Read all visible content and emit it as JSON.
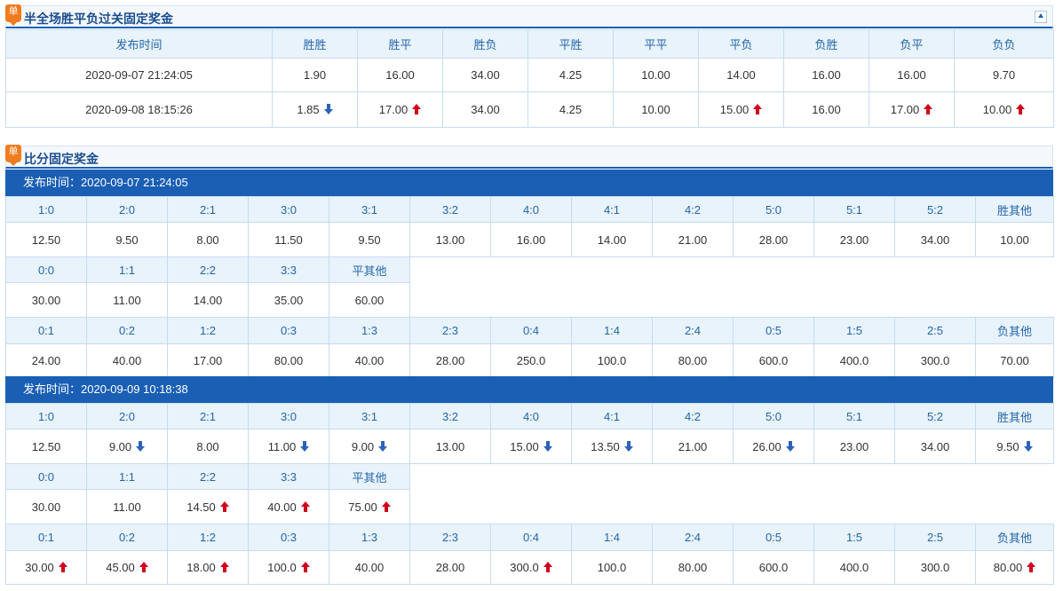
{
  "colors": {
    "accent": "#1a5fb4",
    "header_bg": "#e8f3fc",
    "header_text": "#2566a8",
    "up": "#d0021b",
    "down": "#2c62b8",
    "badge": "#f07c1e"
  },
  "badge_label": "单",
  "halftime": {
    "title": "半全场胜平负过关固定奖金",
    "headers": [
      "发布时间",
      "胜胜",
      "胜平",
      "胜负",
      "平胜",
      "平平",
      "平负",
      "负胜",
      "负平",
      "负负"
    ],
    "rows": [
      {
        "time": "2020-09-07 21:24:05",
        "cells": [
          {
            "v": "1.90",
            "t": ""
          },
          {
            "v": "16.00",
            "t": ""
          },
          {
            "v": "34.00",
            "t": ""
          },
          {
            "v": "4.25",
            "t": ""
          },
          {
            "v": "10.00",
            "t": ""
          },
          {
            "v": "14.00",
            "t": ""
          },
          {
            "v": "16.00",
            "t": ""
          },
          {
            "v": "16.00",
            "t": ""
          },
          {
            "v": "9.70",
            "t": ""
          }
        ]
      },
      {
        "time": "2020-09-08 18:15:26",
        "cells": [
          {
            "v": "1.85",
            "t": "down"
          },
          {
            "v": "17.00",
            "t": "up"
          },
          {
            "v": "34.00",
            "t": ""
          },
          {
            "v": "4.25",
            "t": ""
          },
          {
            "v": "10.00",
            "t": ""
          },
          {
            "v": "15.00",
            "t": "up"
          },
          {
            "v": "16.00",
            "t": ""
          },
          {
            "v": "17.00",
            "t": "up"
          },
          {
            "v": "10.00",
            "t": "up"
          }
        ]
      }
    ]
  },
  "score": {
    "title": "比分固定奖金",
    "publish_label": "发布时间：",
    "win_labels": [
      "1:0",
      "2:0",
      "2:1",
      "3:0",
      "3:1",
      "3:2",
      "4:0",
      "4:1",
      "4:2",
      "5:0",
      "5:1",
      "5:2",
      "胜其他"
    ],
    "draw_labels": [
      "0:0",
      "1:1",
      "2:2",
      "3:3",
      "平其他"
    ],
    "lose_labels": [
      "0:1",
      "0:2",
      "1:2",
      "0:3",
      "1:3",
      "2:3",
      "0:4",
      "1:4",
      "2:4",
      "0:5",
      "1:5",
      "2:5",
      "负其他"
    ],
    "releases": [
      {
        "time": "2020-09-07 21:24:05",
        "win": [
          {
            "v": "12.50",
            "t": ""
          },
          {
            "v": "9.50",
            "t": ""
          },
          {
            "v": "8.00",
            "t": ""
          },
          {
            "v": "11.50",
            "t": ""
          },
          {
            "v": "9.50",
            "t": ""
          },
          {
            "v": "13.00",
            "t": ""
          },
          {
            "v": "16.00",
            "t": ""
          },
          {
            "v": "14.00",
            "t": ""
          },
          {
            "v": "21.00",
            "t": ""
          },
          {
            "v": "28.00",
            "t": ""
          },
          {
            "v": "23.00",
            "t": ""
          },
          {
            "v": "34.00",
            "t": ""
          },
          {
            "v": "10.00",
            "t": ""
          }
        ],
        "draw": [
          {
            "v": "30.00",
            "t": ""
          },
          {
            "v": "11.00",
            "t": ""
          },
          {
            "v": "14.00",
            "t": ""
          },
          {
            "v": "35.00",
            "t": ""
          },
          {
            "v": "60.00",
            "t": ""
          }
        ],
        "lose": [
          {
            "v": "24.00",
            "t": ""
          },
          {
            "v": "40.00",
            "t": ""
          },
          {
            "v": "17.00",
            "t": ""
          },
          {
            "v": "80.00",
            "t": ""
          },
          {
            "v": "40.00",
            "t": ""
          },
          {
            "v": "28.00",
            "t": ""
          },
          {
            "v": "250.0",
            "t": ""
          },
          {
            "v": "100.0",
            "t": ""
          },
          {
            "v": "80.00",
            "t": ""
          },
          {
            "v": "600.0",
            "t": ""
          },
          {
            "v": "400.0",
            "t": ""
          },
          {
            "v": "300.0",
            "t": ""
          },
          {
            "v": "70.00",
            "t": ""
          }
        ]
      },
      {
        "time": "2020-09-09 10:18:38",
        "win": [
          {
            "v": "12.50",
            "t": ""
          },
          {
            "v": "9.00",
            "t": "down"
          },
          {
            "v": "8.00",
            "t": ""
          },
          {
            "v": "11.00",
            "t": "down"
          },
          {
            "v": "9.00",
            "t": "down"
          },
          {
            "v": "13.00",
            "t": ""
          },
          {
            "v": "15.00",
            "t": "down"
          },
          {
            "v": "13.50",
            "t": "down"
          },
          {
            "v": "21.00",
            "t": ""
          },
          {
            "v": "26.00",
            "t": "down"
          },
          {
            "v": "23.00",
            "t": ""
          },
          {
            "v": "34.00",
            "t": ""
          },
          {
            "v": "9.50",
            "t": "down"
          }
        ],
        "draw": [
          {
            "v": "30.00",
            "t": ""
          },
          {
            "v": "11.00",
            "t": ""
          },
          {
            "v": "14.50",
            "t": "up"
          },
          {
            "v": "40.00",
            "t": "up"
          },
          {
            "v": "75.00",
            "t": "up"
          }
        ],
        "lose": [
          {
            "v": "30.00",
            "t": "up"
          },
          {
            "v": "45.00",
            "t": "up"
          },
          {
            "v": "18.00",
            "t": "up"
          },
          {
            "v": "100.0",
            "t": "up"
          },
          {
            "v": "40.00",
            "t": ""
          },
          {
            "v": "28.00",
            "t": ""
          },
          {
            "v": "300.0",
            "t": "up"
          },
          {
            "v": "100.0",
            "t": ""
          },
          {
            "v": "80.00",
            "t": ""
          },
          {
            "v": "600.0",
            "t": ""
          },
          {
            "v": "400.0",
            "t": ""
          },
          {
            "v": "300.0",
            "t": ""
          },
          {
            "v": "80.00",
            "t": "up"
          }
        ]
      }
    ]
  }
}
